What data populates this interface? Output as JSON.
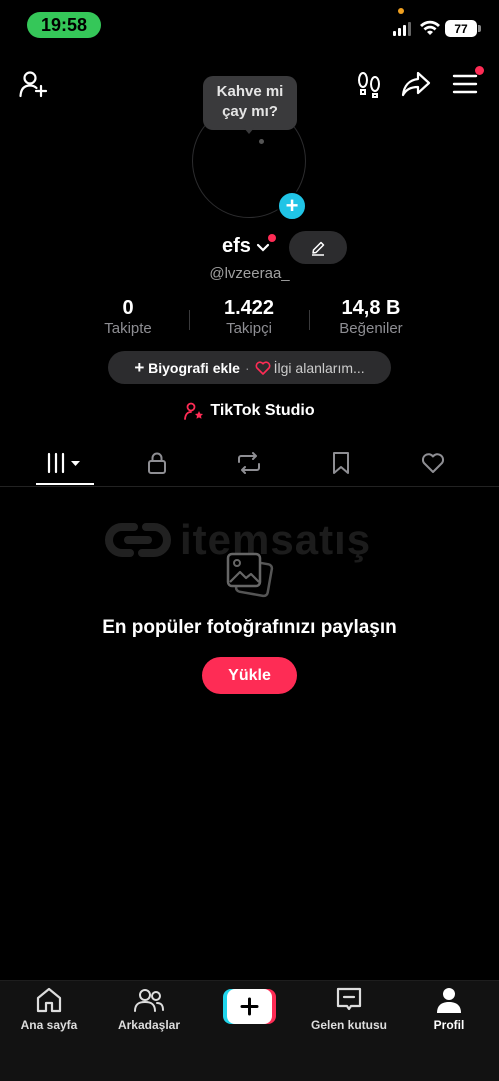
{
  "status_bar": {
    "time": "19:58",
    "battery": "77"
  },
  "profile": {
    "bubble_text": "Kahve mi çay mı?",
    "name": "efs",
    "handle": "@lvzeeraa_"
  },
  "stats": [
    {
      "value": "0",
      "label": "Takipte"
    },
    {
      "value": "1.422",
      "label": "Takipçi"
    },
    {
      "value": "14,8 B",
      "label": "Beğeniler"
    }
  ],
  "bio": {
    "add_bio": "Biyografi ekle",
    "separator": "·",
    "interests": "İlgi alanlarım..."
  },
  "studio_label": "TikTok Studio",
  "watermark": "itemsatış",
  "empty_state": {
    "title": "En popüler fotoğrafınızı paylaşın",
    "button": "Yükle"
  },
  "nav": {
    "home": "Ana sayfa",
    "friends": "Arkadaşlar",
    "inbox": "Gelen kutusu",
    "profile": "Profil"
  },
  "colors": {
    "accent": "#fe2c55",
    "badge": "#20c4e6",
    "status_green": "#35c759"
  }
}
